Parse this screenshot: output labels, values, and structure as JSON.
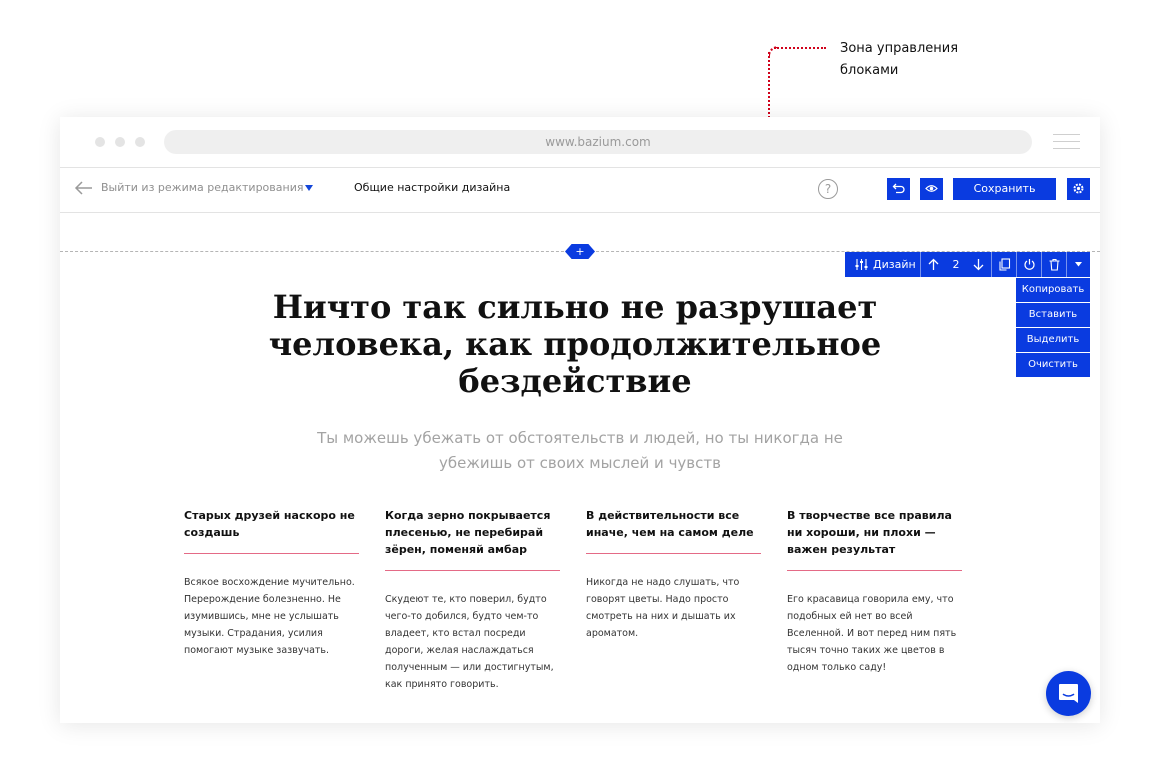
{
  "annotation": {
    "label": "Зона управления блоками",
    "color": "#d0021b"
  },
  "browser": {
    "url": "www.bazium.com",
    "icons": [
      "window-dot-icon",
      "menu-icon"
    ]
  },
  "editor_bar": {
    "exit_label": "Выйти из режима редактирования",
    "design_settings_label": "Общие настройки дизайна",
    "help_symbol": "?",
    "save_label": "Сохранить",
    "icons": [
      "back-arrow-icon",
      "dropdown-caret-icon",
      "undo-icon",
      "eye-icon",
      "gear-icon"
    ],
    "accent_color": "#0a3be0"
  },
  "block": {
    "add_symbol": "+",
    "toolbar": {
      "design_label": "Дизайн",
      "position_number": "2",
      "icons": [
        "sliders-icon",
        "arrow-up-icon",
        "arrow-down-icon",
        "copy-icon",
        "power-icon",
        "trash-icon",
        "chevron-down-icon"
      ]
    },
    "menu_items": [
      "Копировать",
      "Вставить",
      "Выделить",
      "Очистить"
    ]
  },
  "content": {
    "headline": "Ничто так сильно не разрушает человека, как продолжительное бездействие",
    "subtitle": "Ты можешь убежать от обстоятельств и людей, но ты никогда не убежишь от своих мыслей и чувств",
    "divider_color": "#e46a86",
    "columns": [
      {
        "title": "Старых друзей наскоро не создашь",
        "text": "Всякое восхождение мучительно. Перерождение болезненно. Не изумившись, мне не услышать музыки. Страдания, усилия помогают музыке зазвучать."
      },
      {
        "title": "Когда зерно покрывается плесенью, не перебирай зёрен, поменяй амбар",
        "text": "Скудеют те, кто поверил, будто чего-то добился, будто чем-то владеет, кто встал посреди дороги, желая наслаждаться полученным — или достигнутым, как принято говорить."
      },
      {
        "title": "В действительности все иначе, чем на самом деле",
        "text": "Никогда не надо слушать, что говорят цветы. Надо просто смотреть на них и дышать их ароматом."
      },
      {
        "title": "В творчестве все правила ни хороши, ни плохи — важен результат",
        "text": "Его красавица говорила ему, что подобных ей нет во всей Вселенной. И вот перед ним пять тысяч точно таких же цветов в одном только саду!"
      }
    ]
  },
  "chat": {
    "icon": "chat-icon"
  }
}
